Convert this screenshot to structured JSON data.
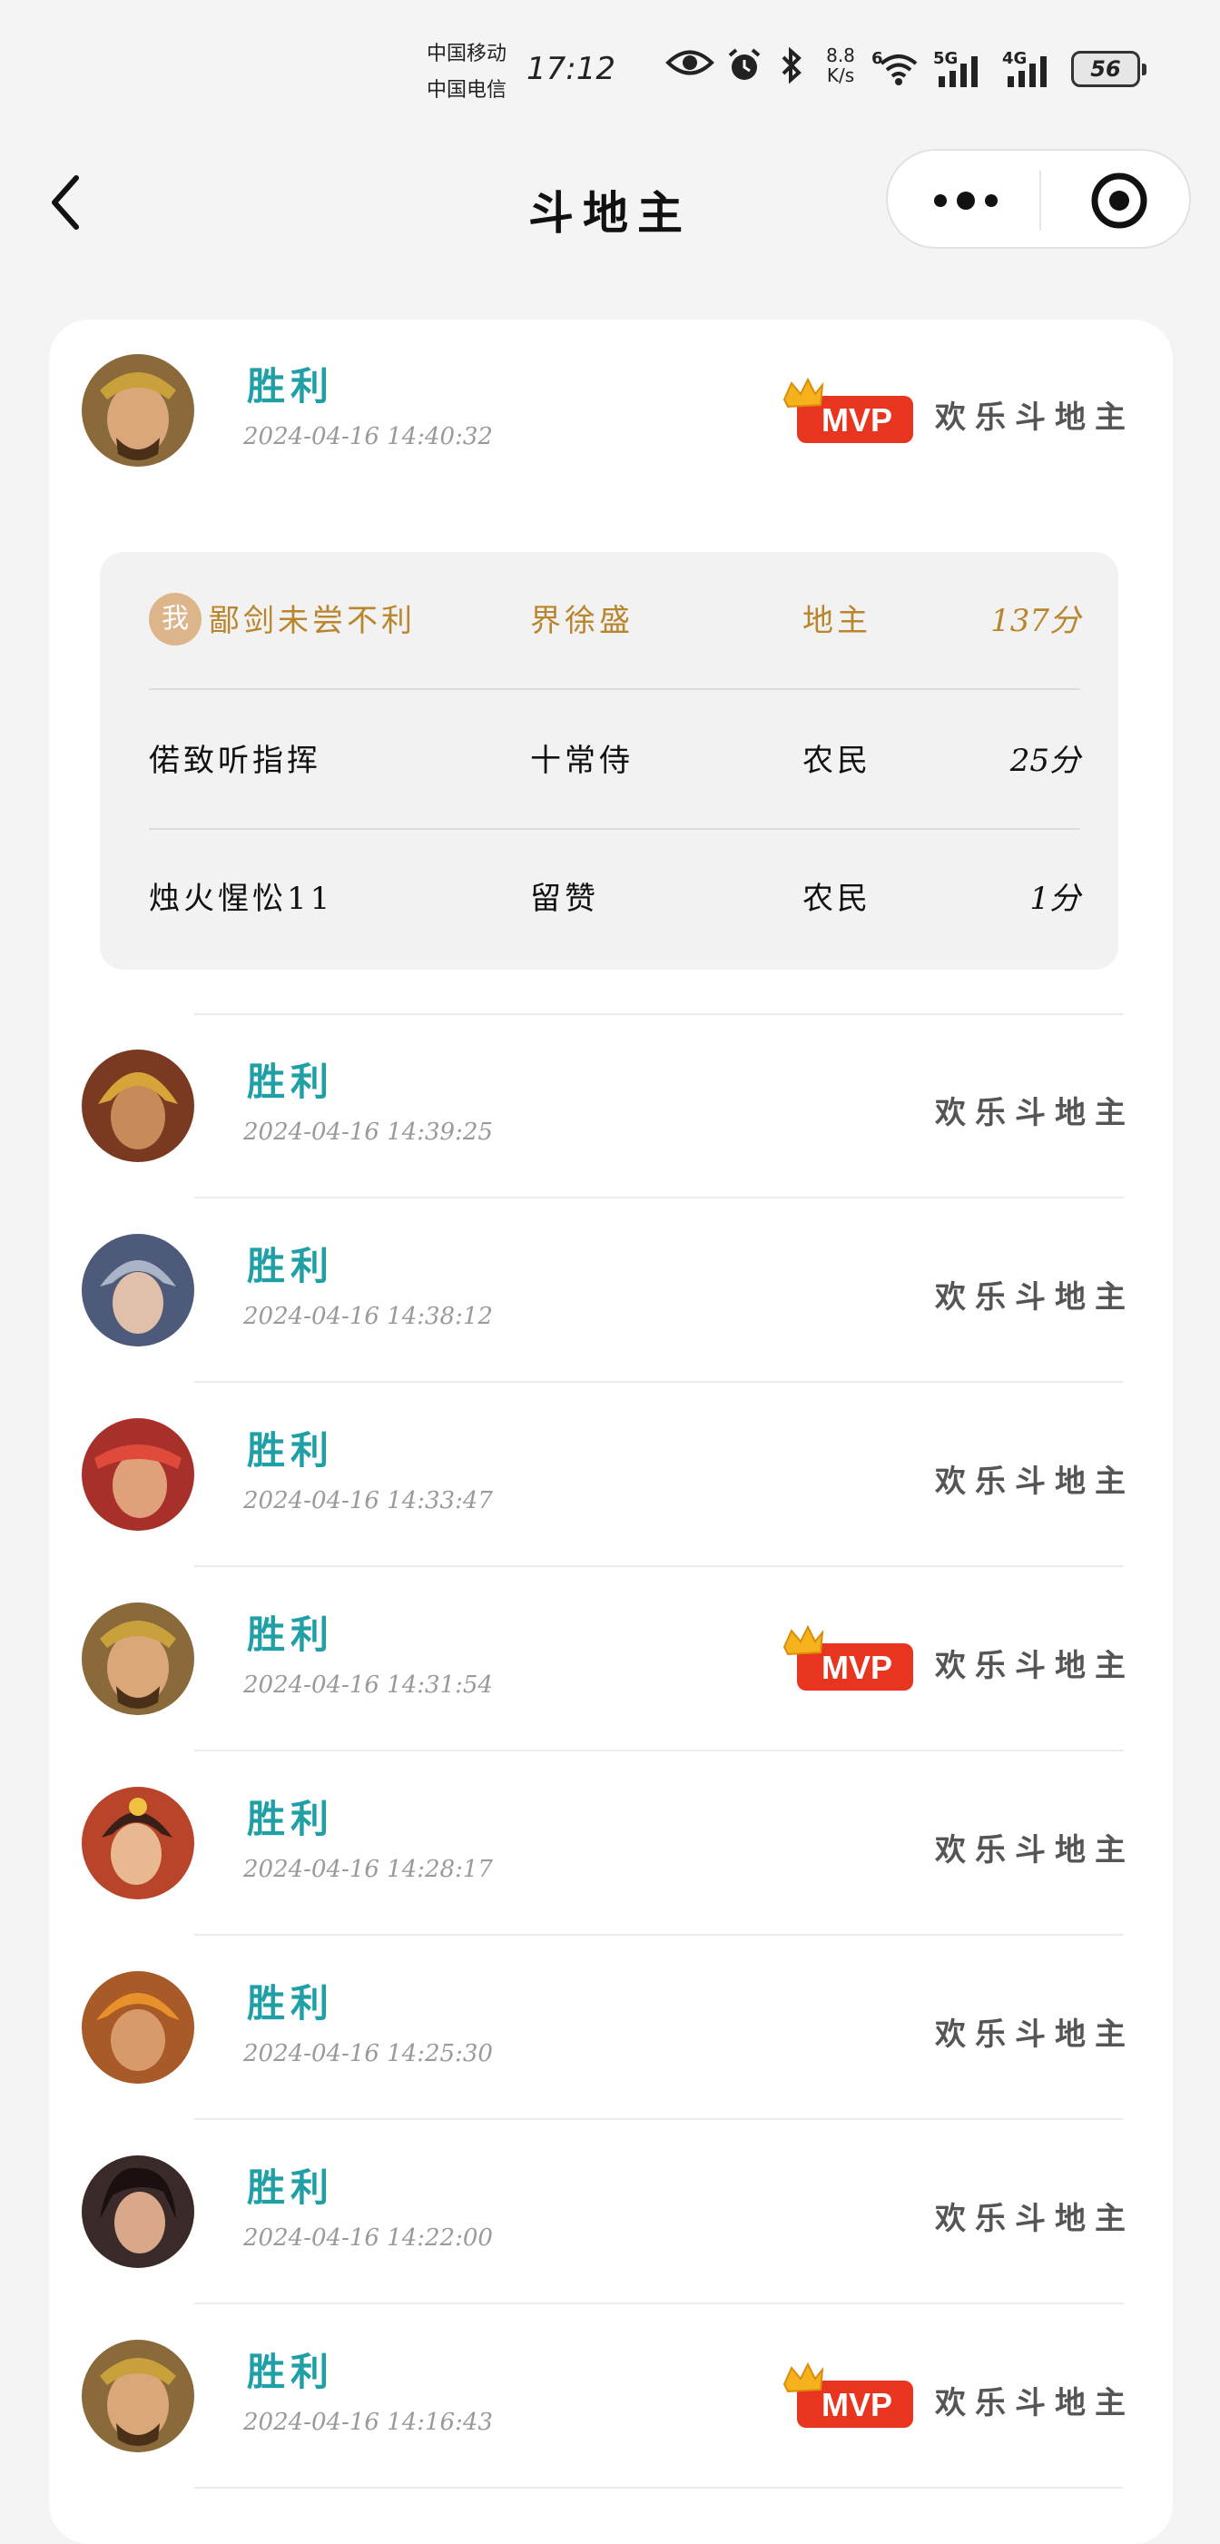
{
  "status_bar": {
    "carrier_1": "中国移动",
    "carrier_2": "中国电信",
    "time": "17:12",
    "speed_value": "8.8",
    "speed_unit": "K/s",
    "sim1_label": "5G",
    "sim1_prefix": "6",
    "sim2_label": "4G",
    "battery": "56",
    "icons": [
      "eye-icon",
      "alarm-icon",
      "bluetooth-icon",
      "wifi-icon",
      "signal-icon",
      "signal-icon",
      "battery-icon"
    ]
  },
  "nav": {
    "title": "斗地主",
    "back_icon": "chevron-left-icon",
    "more_icon": "more-dots-icon",
    "close_icon": "target-circle-icon"
  },
  "first_record_detail": [
    {
      "is_me": true,
      "me_badge": "我",
      "player": "鄙剑未尝不利",
      "hero": "界徐盛",
      "role": "地主",
      "score": "137分"
    },
    {
      "is_me": false,
      "player": "偌致听指挥",
      "hero": "十常侍",
      "role": "农民",
      "score": "25分"
    },
    {
      "is_me": false,
      "player": "烛火惺忪11",
      "hero": "留赞",
      "role": "农民",
      "score": "1分"
    }
  ],
  "records": [
    {
      "result": "胜利",
      "time": "2024-04-16 14:40:32",
      "mode": "欢乐斗地主",
      "mvp": true,
      "avatar_color": "#8a6a3a"
    },
    {
      "result": "胜利",
      "time": "2024-04-16 14:39:25",
      "mode": "欢乐斗地主",
      "mvp": false,
      "avatar_color": "#7a3a22"
    },
    {
      "result": "胜利",
      "time": "2024-04-16 14:38:12",
      "mode": "欢乐斗地主",
      "mvp": false,
      "avatar_color": "#4d5a7a"
    },
    {
      "result": "胜利",
      "time": "2024-04-16 14:33:47",
      "mode": "欢乐斗地主",
      "mvp": false,
      "avatar_color": "#a8302a"
    },
    {
      "result": "胜利",
      "time": "2024-04-16 14:31:54",
      "mode": "欢乐斗地主",
      "mvp": true,
      "avatar_color": "#8a6a3a"
    },
    {
      "result": "胜利",
      "time": "2024-04-16 14:28:17",
      "mode": "欢乐斗地主",
      "mvp": false,
      "avatar_color": "#b8442a"
    },
    {
      "result": "胜利",
      "time": "2024-04-16 14:25:30",
      "mode": "欢乐斗地主",
      "mvp": false,
      "avatar_color": "#a85a28"
    },
    {
      "result": "胜利",
      "time": "2024-04-16 14:22:00",
      "mode": "欢乐斗地主",
      "mvp": false,
      "avatar_color": "#3a2a2a"
    },
    {
      "result": "胜利",
      "time": "2024-04-16 14:16:43",
      "mode": "欢乐斗地主",
      "mvp": true,
      "avatar_color": "#8a6a3a"
    }
  ],
  "mvp_badge_text": "MVP",
  "colors": {
    "result_win": "#1f9fa6",
    "me_row": "#b9852d",
    "mvp_red": "#e8351f",
    "page_bg": "#f4f4f4"
  }
}
